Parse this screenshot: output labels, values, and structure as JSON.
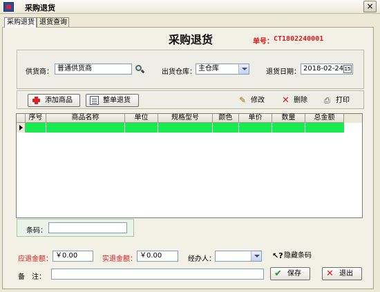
{
  "window": {
    "title": "采购退货",
    "close_label": "×"
  },
  "tabs": [
    {
      "label": "采购退货",
      "active": true
    },
    {
      "label": "退货查询",
      "active": false
    }
  ],
  "header": {
    "title": "采购退货",
    "order_label": "单号：",
    "order_no": "CT1802240001"
  },
  "form": {
    "supplier_label": "供货商：",
    "supplier_value": "普通供货商",
    "warehouse_label": "出货仓库：",
    "warehouse_value": "主仓库",
    "date_label": "退货日期：",
    "date_value": "2018-02-24"
  },
  "toolbar": {
    "add_label": "添加商品",
    "full_return_label": "整单退货",
    "edit_label": "修改",
    "delete_label": "删除",
    "print_label": "打印"
  },
  "table": {
    "columns": [
      "序号",
      "商品名称",
      "单位",
      "规格型号",
      "颜色",
      "单价",
      "数量",
      "总金额"
    ],
    "rows": []
  },
  "barcode": {
    "label": "条码：",
    "value": ""
  },
  "footer": {
    "due_label": "应退金额：",
    "due_value": "￥0.00",
    "actual_label": "实退金额：",
    "actual_value": "￥0.00",
    "operator_label": "经办人：",
    "operator_value": "",
    "hide_barcode_label": "隐藏条码",
    "remark_label": "备　注：",
    "remark_value": "",
    "save_label": "保存",
    "exit_label": "退出"
  },
  "colors": {
    "row_highlight": "#19ea4d",
    "accent_red": "#d51818"
  }
}
